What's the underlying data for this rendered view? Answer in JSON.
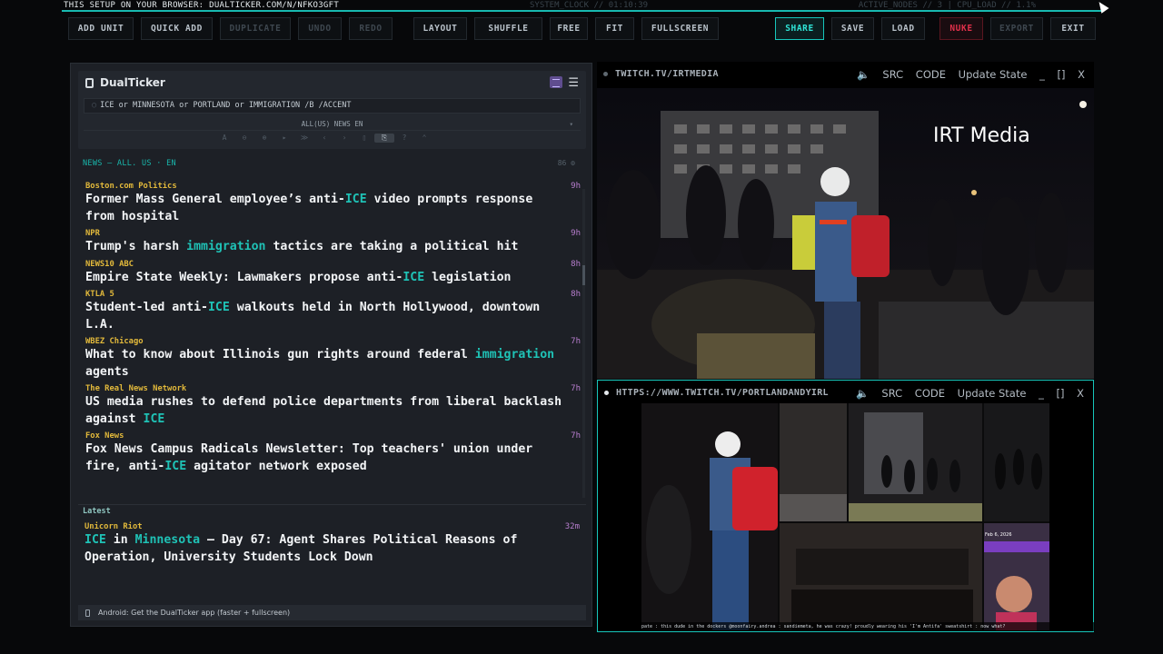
{
  "topbar": {
    "setup_text": "THIS SETUP ON YOUR BROWSER: DUALTICKER.COM/N/NFKO3GFT",
    "clock_text": "SYSTEM_CLOCK // 01:10:39",
    "status_text": "ACTIVE_NODES // 3 | CPU_LOAD // 1.1%",
    "accent_color": "#18b9b0"
  },
  "toolbar": {
    "add_unit": "ADD UNIT",
    "quick_add": "QUICK ADD",
    "duplicate": "DUPLICATE",
    "undo": "UNDO",
    "redo": "REDO",
    "layout": "LAYOUT",
    "shuffle": "SHUFFLE",
    "free": "FREE",
    "fit": "FIT",
    "fullscreen": "FULLSCREEN",
    "share": "SHARE",
    "save": "SAVE",
    "load": "LOAD",
    "nuke": "NUKE",
    "export": "EXPORT",
    "exit": "EXIT"
  },
  "ticker": {
    "app_title": "DualTicker",
    "query": "ICE or MINNESOTA or PORTLAND or IMMIGRATION /B /ACCENT",
    "edition": "ALL(US) NEWS EN",
    "section_label": "NEWS — ALL. US · EN",
    "section_meta": "86",
    "controls": [
      "A",
      "⊖",
      "⊕",
      "▸",
      "≫",
      "‹",
      "›",
      "▯",
      "⎘",
      "?",
      "⌃"
    ],
    "items": [
      {
        "source": "Boston.com Politics",
        "age": "9h",
        "parts": [
          {
            "t": "Former Mass General employee’s anti-"
          },
          {
            "t": "ICE",
            "k": true
          },
          {
            "t": " video prompts response from hospital"
          }
        ]
      },
      {
        "source": "NPR",
        "age": "9h",
        "parts": [
          {
            "t": "Trump's harsh "
          },
          {
            "t": "immigration",
            "k": true
          },
          {
            "t": " tactics are taking a political hit"
          }
        ]
      },
      {
        "source": "NEWS10 ABC",
        "age": "8h",
        "parts": [
          {
            "t": "Empire State Weekly: Lawmakers propose anti-"
          },
          {
            "t": "ICE",
            "k": true
          },
          {
            "t": " legislation"
          }
        ]
      },
      {
        "source": "KTLA 5",
        "age": "8h",
        "parts": [
          {
            "t": "Student-led anti-"
          },
          {
            "t": "ICE",
            "k": true
          },
          {
            "t": " walkouts held in North Hollywood, downtown L.A."
          }
        ]
      },
      {
        "source": "WBEZ Chicago",
        "age": "7h",
        "parts": [
          {
            "t": "What to know about Illinois gun rights around federal "
          },
          {
            "t": "immigration",
            "k": true
          },
          {
            "t": " agents"
          }
        ]
      },
      {
        "source": "The Real News Network",
        "age": "7h",
        "parts": [
          {
            "t": "US media rushes to defend police departments from liberal backlash against "
          },
          {
            "t": "ICE",
            "k": true
          }
        ]
      },
      {
        "source": "Fox News",
        "age": "7h",
        "parts": [
          {
            "t": "Fox News Campus Radicals Newsletter: Top teachers' union under fire, anti-"
          },
          {
            "t": "ICE",
            "k": true
          },
          {
            "t": " agitator network exposed"
          }
        ]
      }
    ],
    "latest_label": "Latest",
    "latest": {
      "source": "Unicorn Riot",
      "age": "32m",
      "parts": [
        {
          "t": "ICE",
          "k": true
        },
        {
          "t": " in "
        },
        {
          "t": "Minnesota",
          "k": true
        },
        {
          "t": " – Day 67: Agent Shares Political Reasons of Operation, University Students Lock Down"
        }
      ]
    },
    "footer_text": "Android: Get the DualTicker app (faster + fullscreen)",
    "source_color": "#e2b93b",
    "age_color": "#b97fd0",
    "keyword_color": "#1fc2b6"
  },
  "streams": [
    {
      "url": "TWITCH.TV/IRTMEDIA",
      "src": "SRC",
      "code": "CODE",
      "update": "Update State",
      "min": "_",
      "max": "[]",
      "close": "X",
      "watermark": "IRT Media"
    },
    {
      "url": "HTTPS://WWW.TWITCH.TV/PORTLANDANDYIRL",
      "src": "SRC",
      "code": "CODE",
      "update": "Update State",
      "min": "_",
      "max": "[]",
      "close": "X",
      "date_badge": "Feb 6, 2026",
      "chat_text": "pate : this dude in the dockers  @moonfairy.andrea : sandiemeta, he was crazy! proudly wearing his 'I'm Antifa' sweatshirt  : now what?"
    }
  ]
}
